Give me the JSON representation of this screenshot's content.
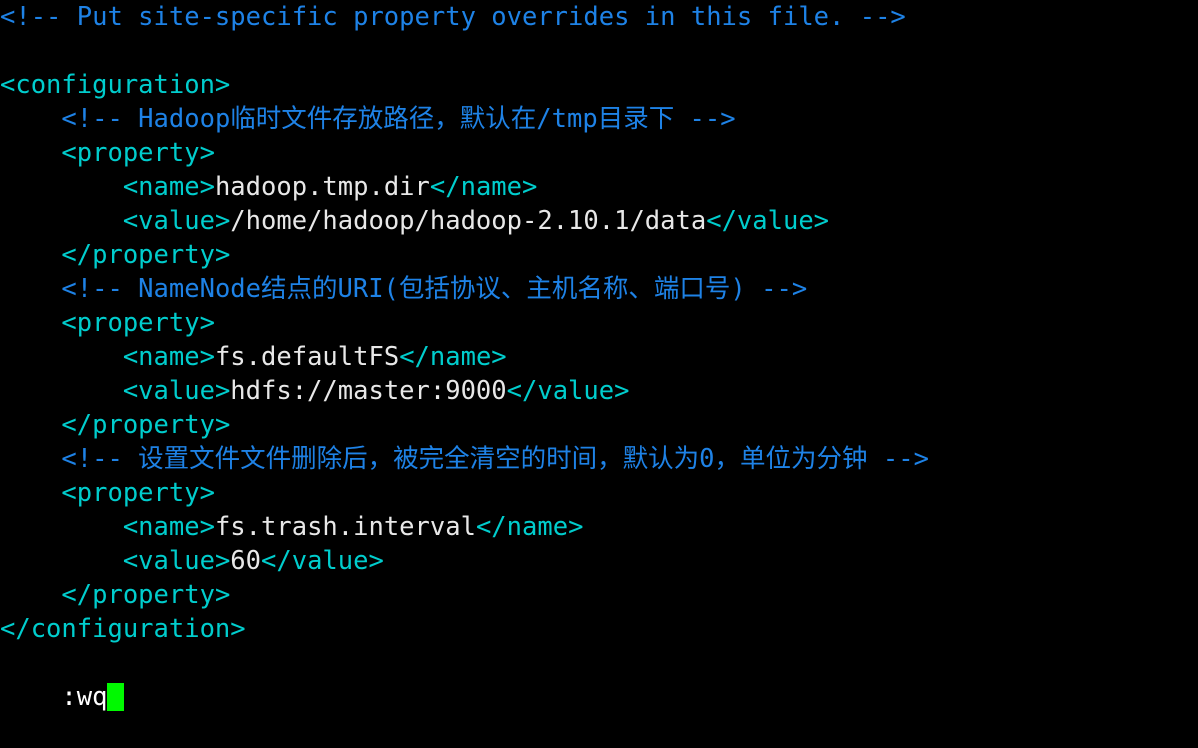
{
  "terminal": {
    "app": "vim",
    "background_color": "#000000",
    "colors": {
      "comment": "#1e82e6",
      "tag": "#00cdcd",
      "text": "#e8e8e8",
      "cursor": "#00f900",
      "status_text": "#ffffff"
    },
    "lines": [
      {
        "indent": "",
        "segments": [
          {
            "kind": "comment",
            "text": "<!-- Put site-specific property overrides in this file. -->"
          }
        ]
      },
      {
        "indent": "",
        "segments": []
      },
      {
        "indent": "",
        "segments": [
          {
            "kind": "tag",
            "text": "<configuration>"
          }
        ]
      },
      {
        "indent": "    ",
        "segments": [
          {
            "kind": "comment",
            "text": "<!-- Hadoop临时文件存放路径，默认在/tmp目录下 -->"
          }
        ]
      },
      {
        "indent": "    ",
        "segments": [
          {
            "kind": "tag",
            "text": "<property>"
          }
        ]
      },
      {
        "indent": "        ",
        "segments": [
          {
            "kind": "tag",
            "text": "<name>"
          },
          {
            "kind": "text",
            "text": "hadoop.tmp.dir"
          },
          {
            "kind": "tag",
            "text": "</name>"
          }
        ]
      },
      {
        "indent": "        ",
        "segments": [
          {
            "kind": "tag",
            "text": "<value>"
          },
          {
            "kind": "text",
            "text": "/home/hadoop/hadoop-2.10.1/data"
          },
          {
            "kind": "tag",
            "text": "</value>"
          }
        ]
      },
      {
        "indent": "    ",
        "segments": [
          {
            "kind": "tag",
            "text": "</property>"
          }
        ]
      },
      {
        "indent": "    ",
        "segments": [
          {
            "kind": "comment",
            "text": "<!-- NameNode结点的URI(包括协议、主机名称、端口号) -->"
          }
        ]
      },
      {
        "indent": "    ",
        "segments": [
          {
            "kind": "tag",
            "text": "<property>"
          }
        ]
      },
      {
        "indent": "        ",
        "segments": [
          {
            "kind": "tag",
            "text": "<name>"
          },
          {
            "kind": "text",
            "text": "fs.defaultFS"
          },
          {
            "kind": "tag",
            "text": "</name>"
          }
        ]
      },
      {
        "indent": "        ",
        "segments": [
          {
            "kind": "tag",
            "text": "<value>"
          },
          {
            "kind": "text",
            "text": "hdfs://master:9000"
          },
          {
            "kind": "tag",
            "text": "</value>"
          }
        ]
      },
      {
        "indent": "    ",
        "segments": [
          {
            "kind": "tag",
            "text": "</property>"
          }
        ]
      },
      {
        "indent": "    ",
        "segments": [
          {
            "kind": "comment",
            "text": "<!-- 设置文件文件删除后，被完全清空的时间，默认为0，单位为分钟 -->"
          }
        ]
      },
      {
        "indent": "    ",
        "segments": [
          {
            "kind": "tag",
            "text": "<property>"
          }
        ]
      },
      {
        "indent": "        ",
        "segments": [
          {
            "kind": "tag",
            "text": "<name>"
          },
          {
            "kind": "text",
            "text": "fs.trash.interval"
          },
          {
            "kind": "tag",
            "text": "</name>"
          }
        ]
      },
      {
        "indent": "        ",
        "segments": [
          {
            "kind": "tag",
            "text": "<value>"
          },
          {
            "kind": "text",
            "text": "60"
          },
          {
            "kind": "tag",
            "text": "</value>"
          }
        ]
      },
      {
        "indent": "    ",
        "segments": [
          {
            "kind": "tag",
            "text": "</property>"
          }
        ]
      },
      {
        "indent": "",
        "segments": [
          {
            "kind": "tag",
            "text": "</configuration>"
          }
        ]
      }
    ],
    "status": {
      "command": ":wq",
      "cursor_visible": true
    }
  }
}
